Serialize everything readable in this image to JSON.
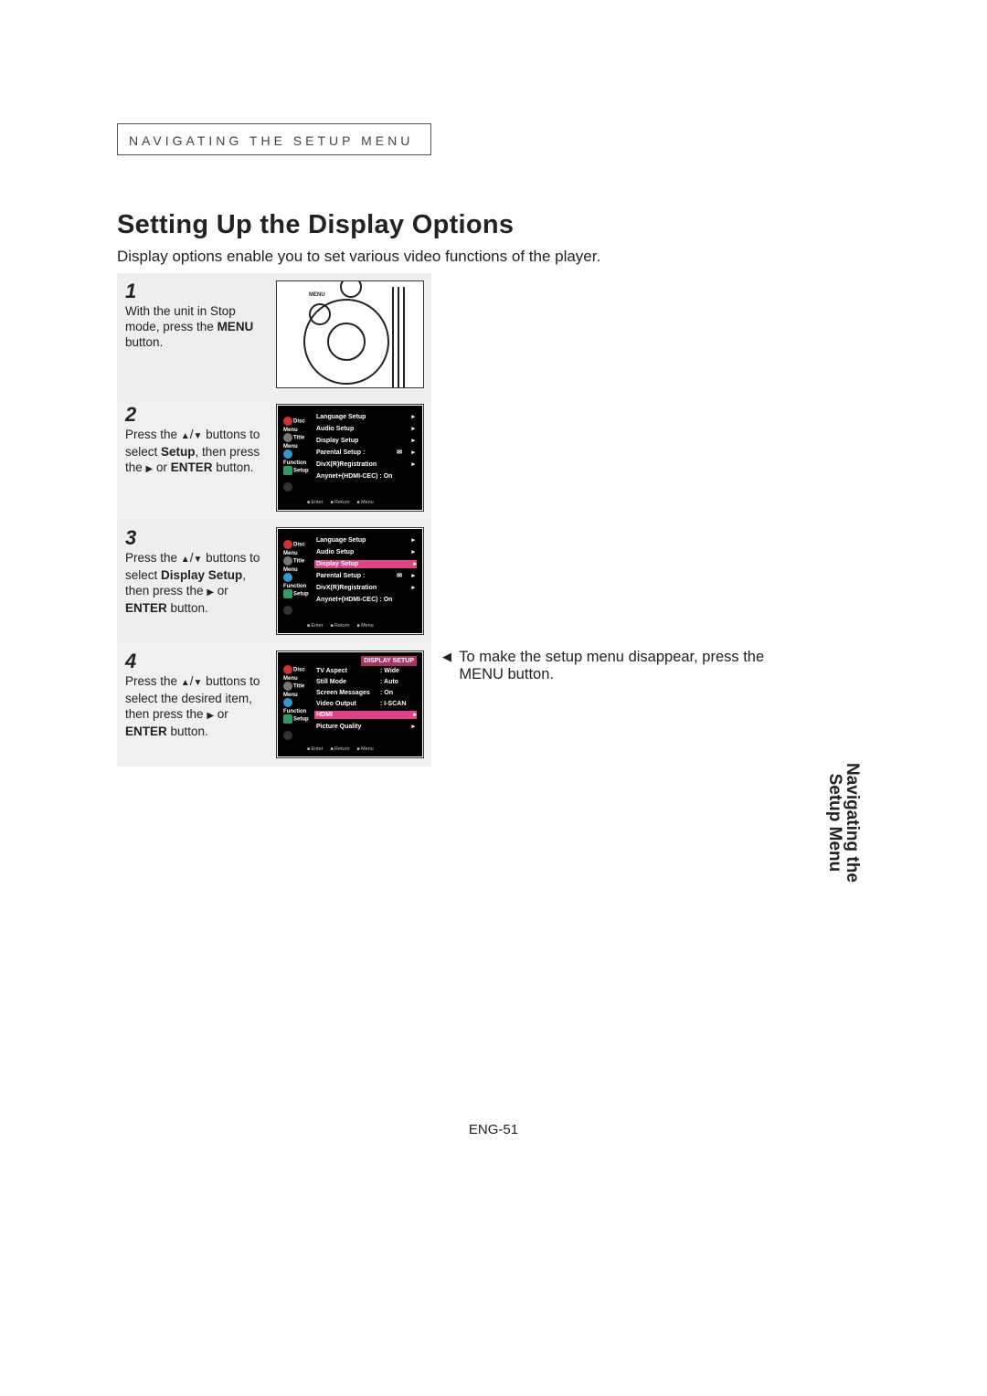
{
  "chapterTag": "NAVIGATING THE SETUP MENU",
  "title": "Setting Up the Display Options",
  "intro": "Display options enable you to set various video functions of the player.",
  "steps": {
    "s1": {
      "num": "1",
      "text_a": "With the unit in Stop mode, press the ",
      "text_b": "MENU",
      "text_c": " button.",
      "menuLabel": "MENU"
    },
    "s2": {
      "num": "2",
      "text_a": "Press the ",
      "text_b": " buttons to select ",
      "text_c": "Setup",
      "text_d": ", then press the ",
      "text_e": " or ",
      "text_f": "ENTER",
      "text_g": " button."
    },
    "s3": {
      "num": "3",
      "text_a": "Press the ",
      "text_b": " buttons to select ",
      "text_c": "Display Setup",
      "text_d": ", then press the ",
      "text_e": " or ",
      "text_f": "ENTER",
      "text_g": " button."
    },
    "s4": {
      "num": "4",
      "text_a": "Press the ",
      "text_b": " buttons to select the desired item, then press the ",
      "text_e": " or ",
      "text_f": "ENTER",
      "text_g": " button."
    }
  },
  "osd": {
    "sideIcons": {
      "discMenu": "Disc Menu",
      "titleMenu": "Title Menu",
      "function": "Function",
      "setup": "Setup"
    },
    "setup": {
      "r1": "Language Setup",
      "r2": "Audio Setup",
      "r3": "Display Setup",
      "r4": "Parental Setup :",
      "r5": "DivX(R)Registration",
      "r6": "Anynet+(HDMI-CEC) : On"
    },
    "display": {
      "header": "DISPLAY SETUP",
      "r1l": "TV Aspect",
      "r1v": ": Wide",
      "r2l": "Still Mode",
      "r2v": ": Auto",
      "r3l": "Screen Messages",
      "r3v": ": On",
      "r4l": "Video Output",
      "r4v": ": I-SCAN",
      "r5l": "HDMI",
      "r6l": "Picture Quality"
    },
    "footer": {
      "enter": "Enter",
      "ret": "Return",
      "menu": "Menu"
    }
  },
  "note": {
    "a": "To make the setup menu disappear, press the",
    "b": "MENU button."
  },
  "sideTab": {
    "line1": "Navigating the",
    "line2": "Setup Menu"
  },
  "pageNum": "ENG-51"
}
